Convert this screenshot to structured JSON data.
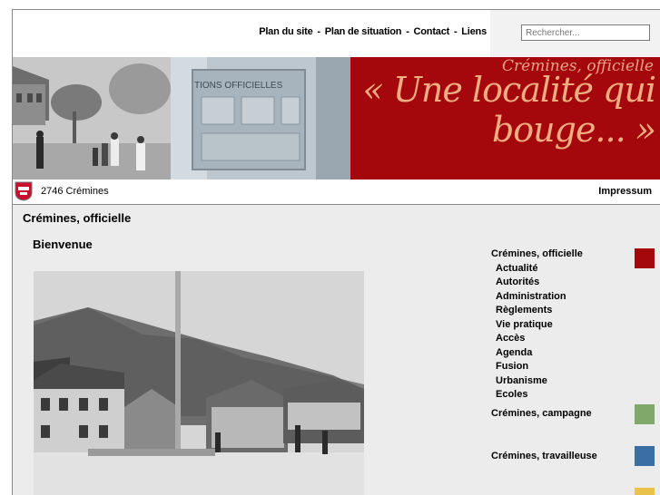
{
  "nav": {
    "links": [
      "Plan du site",
      "Plan de situation",
      "Contact",
      "Liens"
    ],
    "separator": "-"
  },
  "search": {
    "placeholder": "Rechercher..."
  },
  "banner": {
    "photo2_text": "TIONS OFFICIELLES",
    "subtitle": "Crémines, officielle",
    "tagline_line1": "« Une localité qui",
    "tagline_line2": "bouge... »"
  },
  "infobar": {
    "postal": "2746 Crémines",
    "impressum": "Impressum"
  },
  "content": {
    "section_title": "Crémines, officielle",
    "welcome": "Bienvenue"
  },
  "menu": {
    "main": [
      {
        "label": "Crémines, officielle",
        "color": "#a4070c"
      },
      {
        "label": "Crémines, campagne",
        "color": "#7fa86a"
      },
      {
        "label": "Crémines, travailleuse",
        "color": "#3a6ea5"
      }
    ],
    "sub": [
      "Actualité",
      "Autorités",
      "Administration",
      "Règlements",
      "Vie pratique",
      "Accès",
      "Agenda",
      "Fusion",
      "Urbanisme",
      "Ecoles"
    ],
    "partial_swatch_color": "#e9c24a"
  }
}
